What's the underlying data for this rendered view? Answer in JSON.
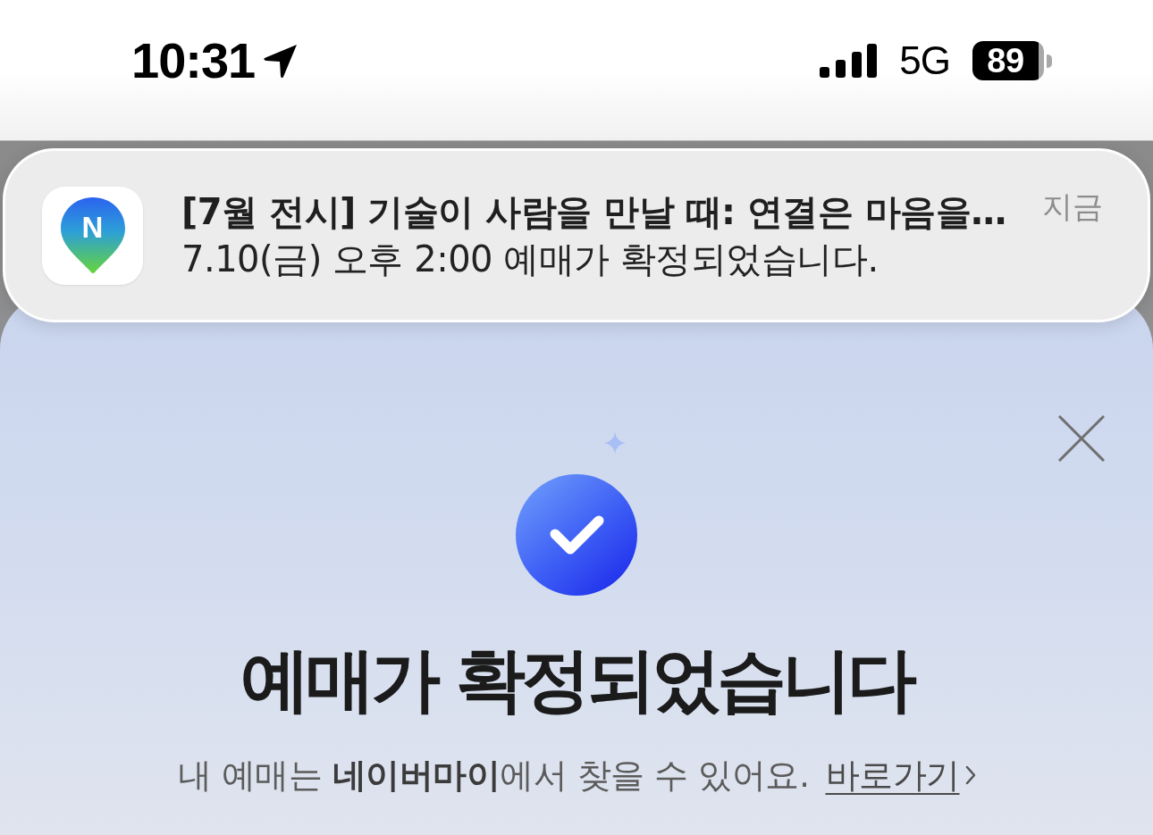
{
  "status_bar": {
    "time": "10:31",
    "network": "5G",
    "battery": "89"
  },
  "notification": {
    "app_letter": "N",
    "title": "[7월 전시] 기술이 사람을 만날 때: 연결은 마음을…",
    "body": "7.10(금) 오후 2:00 예매가 확정되었습니다.",
    "time": "지금"
  },
  "sheet": {
    "title": "예매가 확정되었습니다",
    "message": "내 예매는 **네이버마이**에서 찾을 수 있어요.",
    "link": "바로가기"
  }
}
